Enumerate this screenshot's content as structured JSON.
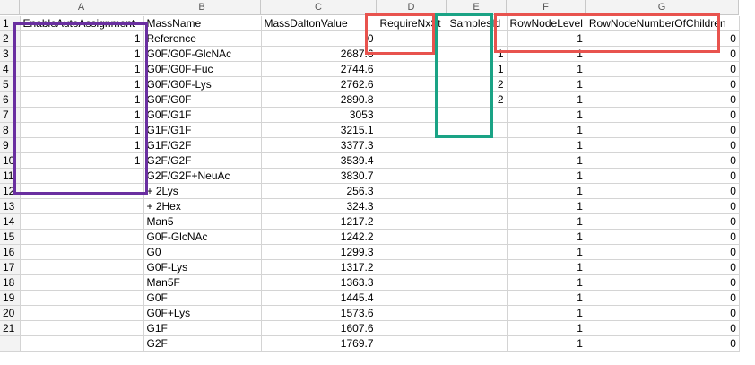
{
  "column_letters": [
    "A",
    "B",
    "C",
    "D",
    "E",
    "F",
    "G"
  ],
  "row_numbers": [
    "1",
    "2",
    "3",
    "4",
    "5",
    "6",
    "7",
    "8",
    "9",
    "10",
    "11",
    "12",
    "13",
    "14",
    "15",
    "16",
    "17",
    "18",
    "19",
    "20",
    "21",
    ""
  ],
  "rows": [
    [
      "EnableAutoAssignment",
      "MassName",
      "MassDaltonValue",
      "RequireNxSt",
      "SamplesId",
      "RowNodeLevel",
      "RowNodeNumberOfChildren"
    ],
    [
      "1",
      "Reference",
      "0",
      "",
      "",
      "1",
      "0"
    ],
    [
      "1",
      "G0F/G0F-GlcNAc",
      "2687.6",
      "",
      "1",
      "1",
      "0"
    ],
    [
      "1",
      "G0F/G0F-Fuc",
      "2744.6",
      "",
      "1",
      "1",
      "0"
    ],
    [
      "1",
      "G0F/G0F-Lys",
      "2762.6",
      "",
      "2",
      "1",
      "0"
    ],
    [
      "1",
      "G0F/G0F",
      "2890.8",
      "",
      "2",
      "1",
      "0"
    ],
    [
      "1",
      "G0F/G1F",
      "3053",
      "",
      "",
      "1",
      "0"
    ],
    [
      "1",
      "G1F/G1F",
      "3215.1",
      "",
      "",
      "1",
      "0"
    ],
    [
      "1",
      "G1F/G2F",
      "3377.3",
      "",
      "",
      "1",
      "0"
    ],
    [
      "1",
      "G2F/G2F",
      "3539.4",
      "",
      "",
      "1",
      "0"
    ],
    [
      "",
      "G2F/G2F+NeuAc",
      "3830.7",
      "",
      "",
      "1",
      "0"
    ],
    [
      "",
      "+ 2Lys",
      "256.3",
      "",
      "",
      "1",
      "0"
    ],
    [
      "",
      "+ 2Hex",
      "324.3",
      "",
      "",
      "1",
      "0"
    ],
    [
      "",
      "Man5",
      "1217.2",
      "",
      "",
      "1",
      "0"
    ],
    [
      "",
      "G0F-GlcNAc",
      "1242.2",
      "",
      "",
      "1",
      "0"
    ],
    [
      "",
      "G0",
      "1299.3",
      "",
      "",
      "1",
      "0"
    ],
    [
      "",
      "G0F-Lys",
      "1317.2",
      "",
      "",
      "1",
      "0"
    ],
    [
      "",
      "Man5F",
      "1363.3",
      "",
      "",
      "1",
      "0"
    ],
    [
      "",
      "G0F",
      "1445.4",
      "",
      "",
      "1",
      "0"
    ],
    [
      "",
      "G0F+Lys",
      "1573.6",
      "",
      "",
      "1",
      "0"
    ],
    [
      "",
      "G1F",
      "1607.6",
      "",
      "",
      "1",
      "0"
    ],
    [
      "",
      "G2F",
      "1769.7",
      "",
      "",
      "1",
      "0"
    ]
  ],
  "highlight_colors": {
    "purple": "#6a2fa0",
    "red": "#e8534e",
    "teal": "#1aa385"
  }
}
